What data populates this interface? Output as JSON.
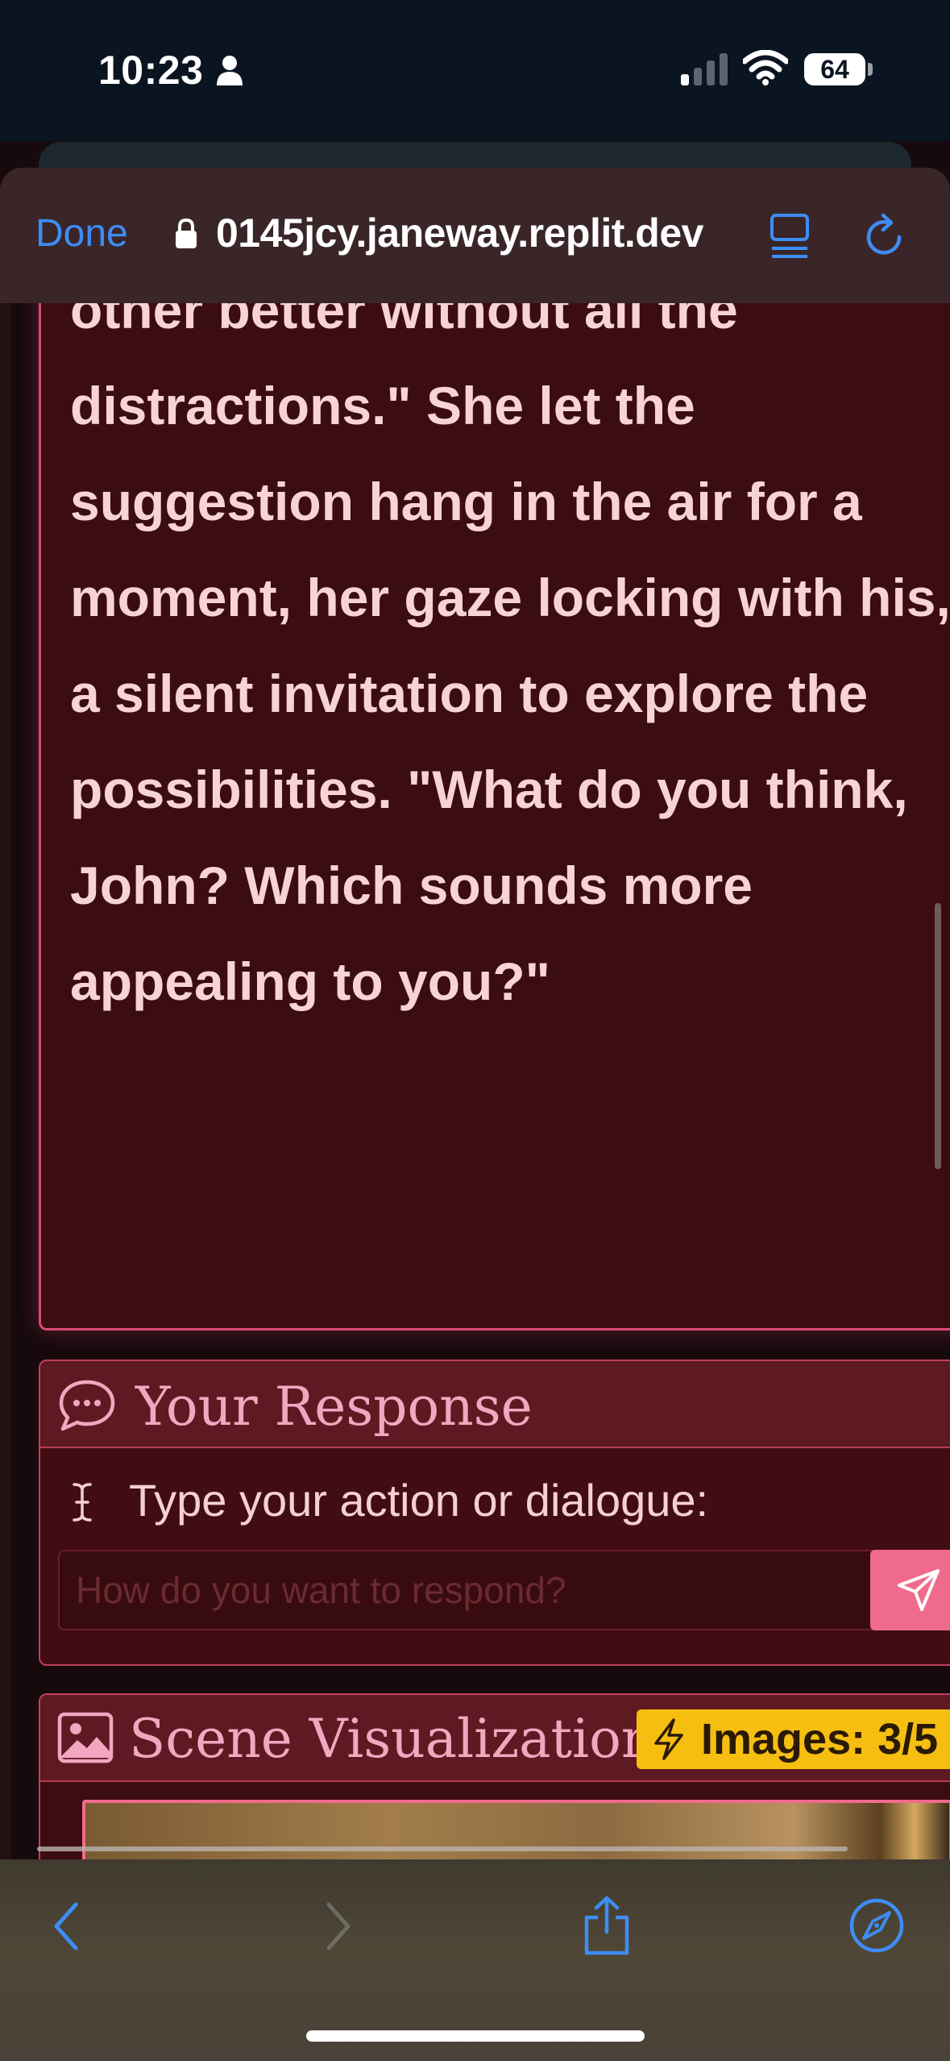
{
  "status_bar": {
    "time": "10:23",
    "battery": "64"
  },
  "browser": {
    "done_label": "Done",
    "url": "0145jcy.janeway.replit.dev"
  },
  "story": {
    "partial_line": "other better without all the",
    "text": "distractions.\" She let the suggestion hang in the air for a moment, her gaze locking with his, a silent invitation to explore the possibilities. \"What do you think, John? Which sounds more appealing to you?\""
  },
  "response": {
    "title": "Your Response",
    "label": "Type your action or dialogue:",
    "placeholder": "How do you want to respond?"
  },
  "scene": {
    "title": "Scene Visualization",
    "badge": "Images: 3/5"
  },
  "colors": {
    "accent_pink": "#f06b8b",
    "panel_border": "#c0405e",
    "badge_yellow": "#f5be11",
    "link_blue": "#3e8df5"
  }
}
